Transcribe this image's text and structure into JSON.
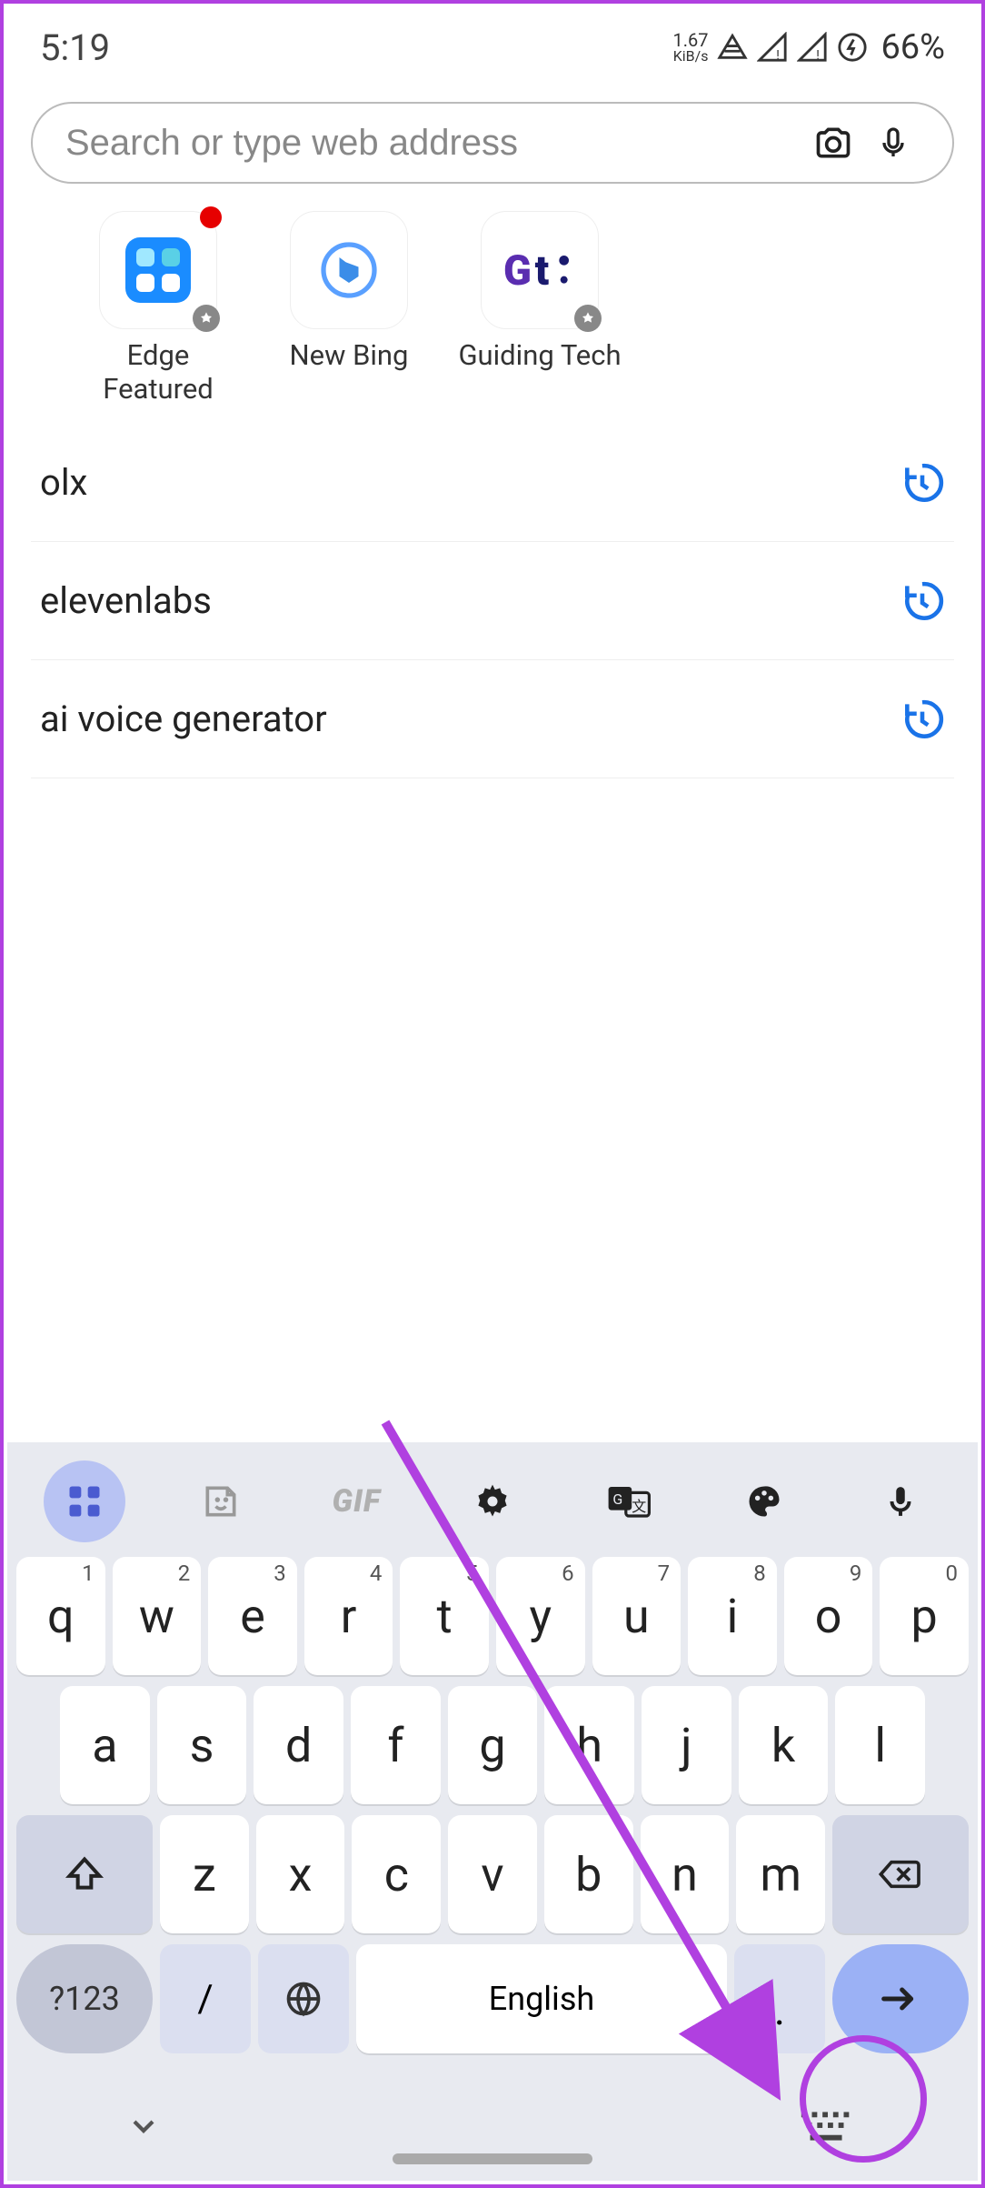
{
  "status": {
    "time": "5:19",
    "kib_rate": "1.67",
    "kib_unit": "KiB/s",
    "battery": "66%"
  },
  "search": {
    "placeholder": "Search or type web address"
  },
  "bookmarks": [
    {
      "label": "Edge Featured"
    },
    {
      "label": "New Bing"
    },
    {
      "label": "Guiding Tech"
    }
  ],
  "history": [
    {
      "text": "olx"
    },
    {
      "text": "elevenlabs"
    },
    {
      "text": "ai voice generator"
    }
  ],
  "keyboard": {
    "toolbar_gif": "GIF",
    "row1": [
      {
        "k": "q",
        "n": "1"
      },
      {
        "k": "w",
        "n": "2"
      },
      {
        "k": "e",
        "n": "3"
      },
      {
        "k": "r",
        "n": "4"
      },
      {
        "k": "t",
        "n": "5"
      },
      {
        "k": "y",
        "n": "6"
      },
      {
        "k": "u",
        "n": "7"
      },
      {
        "k": "i",
        "n": "8"
      },
      {
        "k": "o",
        "n": "9"
      },
      {
        "k": "p",
        "n": "0"
      }
    ],
    "row2": [
      {
        "k": "a"
      },
      {
        "k": "s"
      },
      {
        "k": "d"
      },
      {
        "k": "f"
      },
      {
        "k": "g"
      },
      {
        "k": "h"
      },
      {
        "k": "j"
      },
      {
        "k": "k"
      },
      {
        "k": "l"
      }
    ],
    "row3": [
      {
        "k": "z"
      },
      {
        "k": "x"
      },
      {
        "k": "c"
      },
      {
        "k": "v"
      },
      {
        "k": "b"
      },
      {
        "k": "n"
      },
      {
        "k": "m"
      }
    ],
    "sym_key": "?123",
    "slash_key": "/",
    "space_label": "English"
  }
}
